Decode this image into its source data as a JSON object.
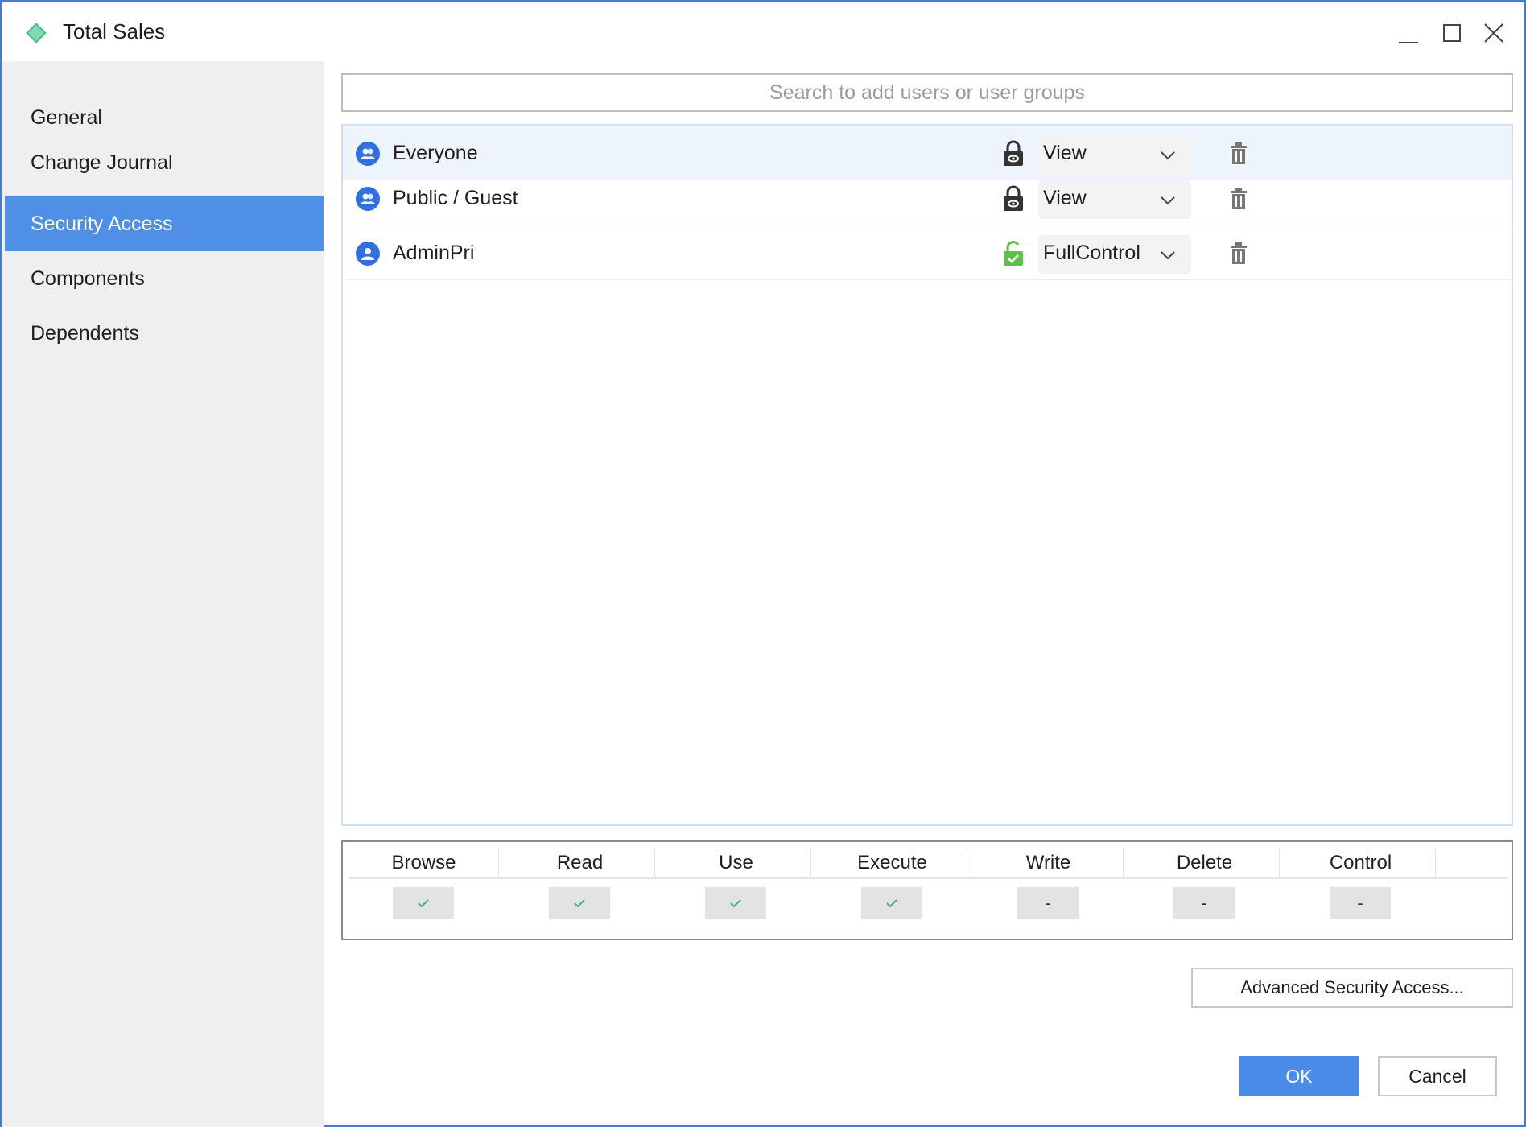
{
  "window": {
    "title": "Total Sales",
    "icon": "diamond-icon"
  },
  "sidebar": {
    "items": [
      {
        "label": "General",
        "active": false
      },
      {
        "label": "Change Journal",
        "active": false
      },
      {
        "label": "Security Access",
        "active": true
      },
      {
        "label": "Components",
        "active": false
      },
      {
        "label": "Dependents",
        "active": false
      }
    ]
  },
  "search": {
    "placeholder": "Search to add users or user groups"
  },
  "users": [
    {
      "name": "Everyone",
      "type": "group",
      "lock": "locked",
      "permission": "View"
    },
    {
      "name": "Public / Guest",
      "type": "group",
      "lock": "locked",
      "permission": "View"
    },
    {
      "name": "AdminPri",
      "type": "user",
      "lock": "unlocked",
      "permission": "FullControl"
    }
  ],
  "permissions": {
    "columns": [
      {
        "label": "Browse",
        "value": "check"
      },
      {
        "label": "Read",
        "value": "check"
      },
      {
        "label": "Use",
        "value": "check"
      },
      {
        "label": "Execute",
        "value": "check"
      },
      {
        "label": "Write",
        "value": "-"
      },
      {
        "label": "Delete",
        "value": "-"
      },
      {
        "label": "Control",
        "value": "-"
      }
    ]
  },
  "buttons": {
    "advanced": "Advanced Security Access...",
    "ok": "OK",
    "cancel": "Cancel"
  },
  "colors": {
    "accent": "#4a8be8",
    "sidebar_active": "#4f8fe6",
    "check": "#3bb07a",
    "unlocked": "#5cc04a",
    "locked": "#333333"
  }
}
